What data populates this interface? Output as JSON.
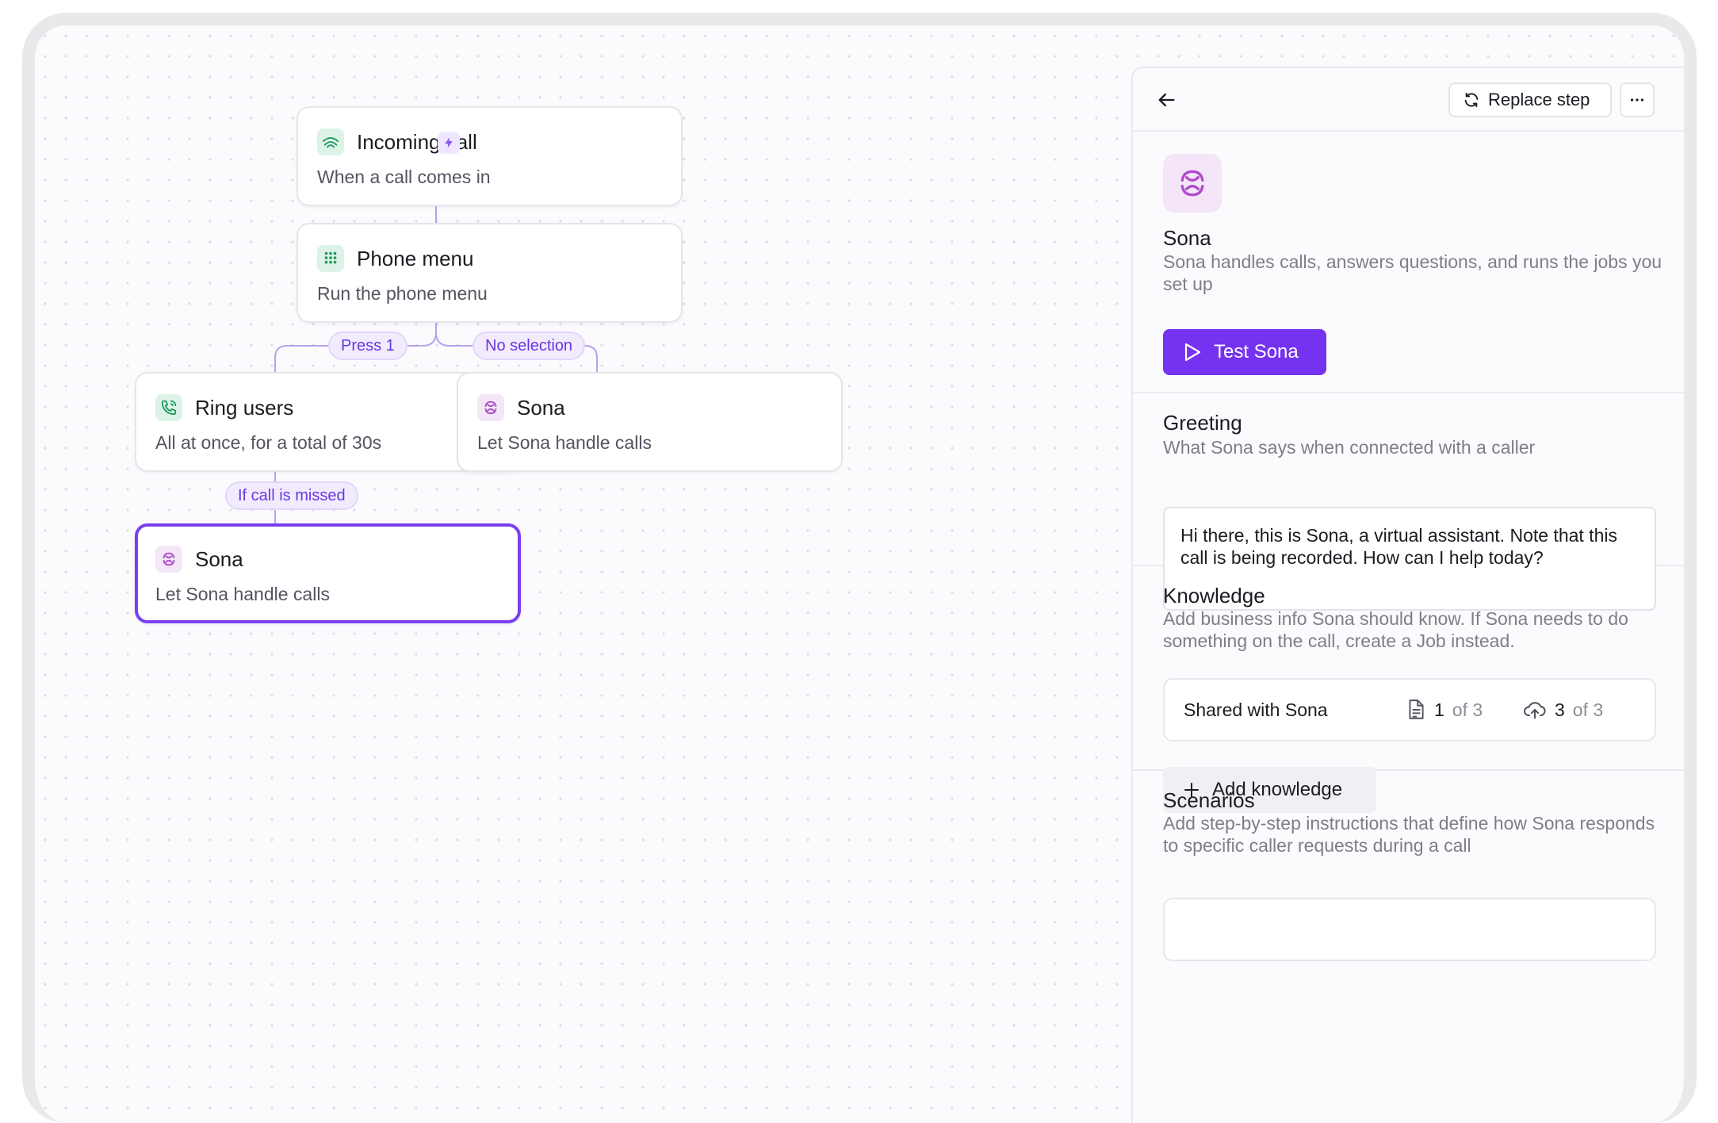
{
  "flow": {
    "incoming": {
      "title": "Incoming call",
      "subtitle": "When a call comes in"
    },
    "menu": {
      "title": "Phone menu",
      "subtitle": "Run the phone menu"
    },
    "ring": {
      "title": "Ring users",
      "subtitle": "All at once, for a total of 30s"
    },
    "sona_right": {
      "title": "Sona",
      "subtitle": "Let Sona handle calls"
    },
    "sona_selected": {
      "title": "Sona",
      "subtitle": "Let Sona handle calls"
    },
    "branches": {
      "press1": "Press 1",
      "no_selection": "No selection",
      "missed": "If call is missed"
    }
  },
  "panel": {
    "replace_label": "Replace step",
    "name": "Sona",
    "description": "Sona handles calls, answers questions, and runs the jobs you set up",
    "test_label": "Test Sona",
    "greeting": {
      "title": "Greeting",
      "description": "What Sona says when connected with a caller",
      "text": "Hi there, this is Sona, a virtual assistant. Note that this call is being recorded. How can I help today?"
    },
    "knowledge": {
      "title": "Knowledge",
      "description": "Add business info Sona should know. If Sona needs to do something on the call, create a Job instead.",
      "shared_label": "Shared with Sona",
      "docs_count": "1",
      "docs_total": "of 3",
      "uploads_count": "3",
      "uploads_total": "of 3",
      "add_label": "Add knowledge"
    },
    "scenarios": {
      "title": "Scenarios",
      "description": "Add step-by-step instructions that define how Sona responds to specific caller requests during a call"
    }
  },
  "colors": {
    "accent": "#7532f0",
    "green_icon": "#1f9a5d",
    "sona_icon": "#b04bc9"
  }
}
